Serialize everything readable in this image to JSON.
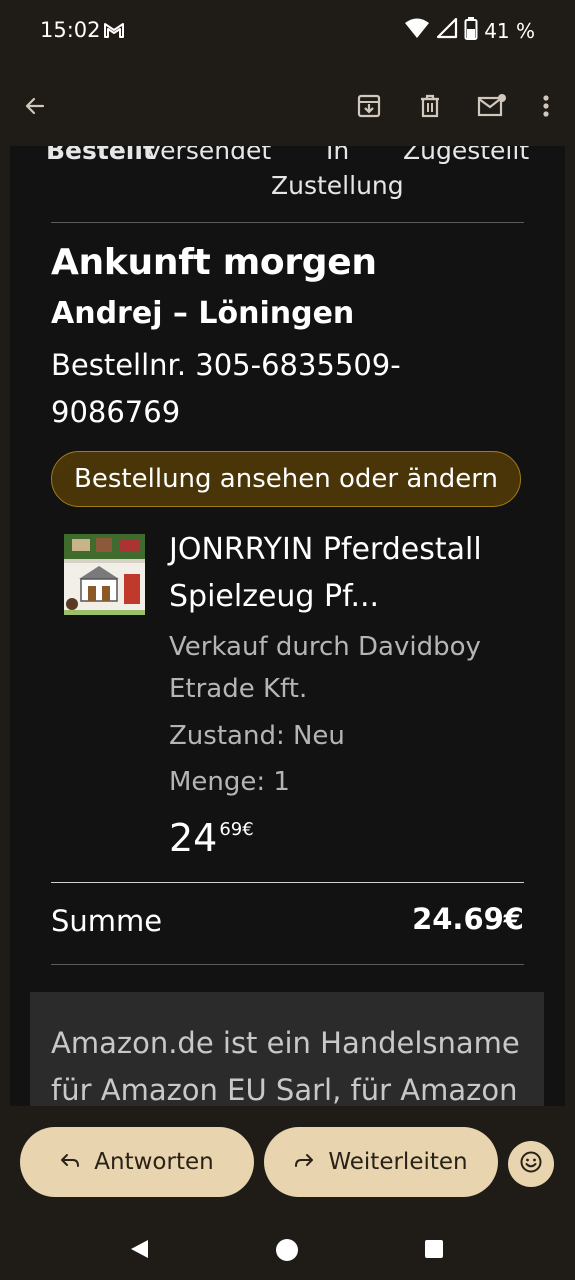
{
  "status": {
    "time": "15:02",
    "battery": "41 %"
  },
  "appbar": {
    "icons": [
      "back-arrow-icon",
      "archive-icon",
      "delete-icon",
      "mark-unread-icon",
      "more-vert-icon"
    ]
  },
  "email": {
    "steps": [
      "Bestellt",
      "Versendet",
      "In",
      "Zustellung",
      "Zugestellt"
    ],
    "arrival": "Ankunft morgen",
    "recipient": "Andrej – Löningen",
    "order_line1": "Bestellnr. 305-6835509-",
    "order_line2": "9086769",
    "view_button": "Bestellung ansehen oder ändern",
    "product": {
      "title_line1": "JONRRYIN Pferdestall",
      "title_line2": "Spielzeug Pf...",
      "seller_line1": "Verkauf durch Davidboy",
      "seller_line2": "Etrade Kft.",
      "condition": "Zustand: Neu",
      "quantity": "Menge: 1",
      "price_main": "24",
      "price_cents": "69€"
    },
    "sum_label": "Summe",
    "sum_value": "24.69€",
    "footer_line1": "Amazon.de ist ein Handelsname",
    "footer_line2": "für Amazon EU Sarl, für Amazon"
  },
  "actions": {
    "reply": "Antworten",
    "forward": "Weiterleiten"
  },
  "colors": {
    "background": "#1f1b16",
    "content_bg": "#121212",
    "pill_bg": "#4a3508",
    "pill_border": "#a37a1a",
    "action_bg": "#e8d5b0"
  }
}
